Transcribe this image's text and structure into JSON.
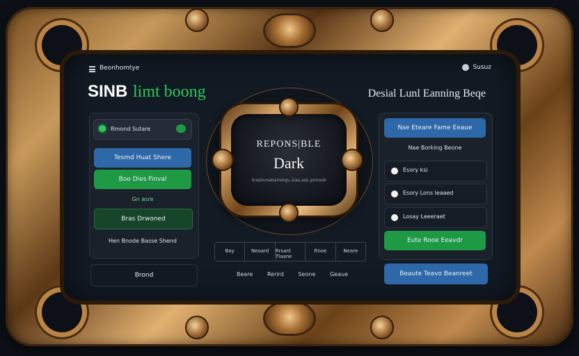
{
  "header": {
    "brand_small": "Beonhomtye",
    "user_label": "Susuz",
    "logo_white": "SINB",
    "logo_green": "limt boong",
    "page_heading": "Desial Lunl Eanning Beqe"
  },
  "left_panel": {
    "toggle_label": "Rmond Sutare",
    "btn1": "Tesmd Huat Shere",
    "btn2": "Boo Dies Finval",
    "label_green": "Gn asre",
    "btn3": "Bras Drwoned",
    "footer_text": "Hen Bnode Basse Shend",
    "bottom_button": "Brond"
  },
  "center": {
    "line1": "REPONS|BLE",
    "line2": "Dark",
    "line3": "Srediomabaindrgu oiaa aos prmoob"
  },
  "tabs": [
    "Bay",
    "Neoard",
    "Rrsanl Tlaane",
    "Rnoe",
    "Neare"
  ],
  "bottom_links": [
    "Beare",
    "Rerird",
    "Seone",
    "Geaue"
  ],
  "right_panel": {
    "btn1": "Nse Eteare Fame Eeaue",
    "label1": "Nae Borking Beone",
    "options": [
      "Esory ksi",
      "Esory Lons leaaed",
      "Losay Leeeraet"
    ],
    "btn2": "Eute Rooe Eeavdr",
    "bottom_button": "Beaute Teavo Beanreet"
  },
  "colors": {
    "accent_green": "#2bc95b",
    "accent_blue": "#2f68a8",
    "frame_gold": "#c79a5b"
  }
}
